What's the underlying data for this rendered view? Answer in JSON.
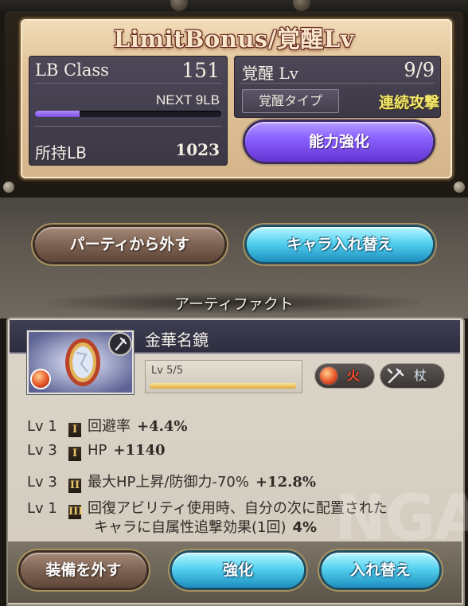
{
  "limit_bonus": {
    "title": "LimitBonus/覚醒Lv",
    "lb_class_label": "LB Class",
    "lb_class_value": "151",
    "next_lb": "NEXT 9LB",
    "next_lb_progress_fraction": 0.24,
    "owned_lb_label": "所持LB",
    "owned_lb_value": "1023",
    "awaken_lv_label": "覚醒 Lv",
    "awaken_lv_value": "9/9",
    "awaken_type_label": "覚醒タイプ",
    "awaken_type_value": "連続攻撃",
    "power_up_button": "能力強化"
  },
  "party_actions": {
    "leave_party_button": "パーティから外す",
    "swap_chara_button": "キャラ入れ替え"
  },
  "artifact": {
    "heading": "アーティファクト",
    "name": "金華名鏡",
    "level_label": "Lv 5/5",
    "level_fraction": 1.0,
    "element_label": "火",
    "weapon_label": "杖",
    "bonuses": [
      {
        "lv": "Lv 1",
        "tier": "I",
        "name": "回避率",
        "value": "+4.4%"
      },
      {
        "lv": "Lv 3",
        "tier": "I",
        "name": "HP",
        "value": "+1140"
      },
      {
        "lv": "Lv 3",
        "tier": "II",
        "name": "最大HP上昇/防御力-70%",
        "value": "+12.8%"
      },
      {
        "lv": "Lv 1",
        "tier": "III",
        "name": "回復アビリティ使用時、自分の次に配置された",
        "name_cont": "キャラに自属性追撃効果(1回)",
        "value": "4%"
      }
    ],
    "watermark": "NGA"
  },
  "bottom_actions": {
    "unequip_button": "装備を外す",
    "enhance_button": "強化",
    "replace_button": "入れ替え"
  },
  "colors": {
    "lb_bar": "#8a62ff",
    "lv_bar": "#e8bf5a",
    "awaken_type_text": "#f6e96a",
    "fire_text": "#ff4c2e"
  }
}
